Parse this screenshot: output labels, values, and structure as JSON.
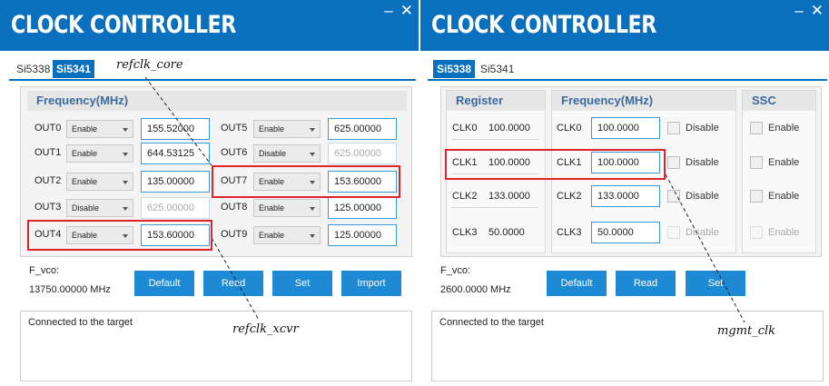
{
  "left": {
    "title": "CLOCK CONTROLLER",
    "window_controls": {
      "minimize": "–",
      "close": "✕"
    },
    "tabs": [
      {
        "label": "Si5338",
        "active": false
      },
      {
        "label": "Si5341",
        "active": true
      }
    ],
    "group_title": "Frequency(MHz)",
    "outputs": [
      {
        "name": "OUT0",
        "mode": "Enable",
        "freq": "155.52000",
        "enabled": true
      },
      {
        "name": "OUT1",
        "mode": "Enable",
        "freq": "644.53125",
        "enabled": true
      },
      {
        "name": "OUT2",
        "mode": "Enable",
        "freq": "135.00000",
        "enabled": true
      },
      {
        "name": "OUT3",
        "mode": "Disable",
        "freq": "625.00000",
        "enabled": false
      },
      {
        "name": "OUT4",
        "mode": "Enable",
        "freq": "153.60000",
        "enabled": true
      },
      {
        "name": "OUT5",
        "mode": "Enable",
        "freq": "625.00000",
        "enabled": true
      },
      {
        "name": "OUT6",
        "mode": "Disable",
        "freq": "625.00000",
        "enabled": false
      },
      {
        "name": "OUT7",
        "mode": "Enable",
        "freq": "153.60000",
        "enabled": true
      },
      {
        "name": "OUT8",
        "mode": "Enable",
        "freq": "125.00000",
        "enabled": true
      },
      {
        "name": "OUT9",
        "mode": "Enable",
        "freq": "125.00000",
        "enabled": true
      }
    ],
    "fvco_label": "F_vco:",
    "fvco_value": "13750.00000 MHz",
    "buttons": {
      "default": "Default",
      "read": "Read",
      "set": "Set",
      "import": "Import"
    },
    "status": "Connected to the target"
  },
  "right": {
    "title": "CLOCK CONTROLLER",
    "window_controls": {
      "minimize": "–",
      "close": "✕"
    },
    "tabs": [
      {
        "label": "Si5338",
        "active": true
      },
      {
        "label": "Si5341",
        "active": false
      }
    ],
    "headers": {
      "register": "Register",
      "frequency": "Frequency(MHz)",
      "ssc": "SSC"
    },
    "clocks": [
      {
        "name": "CLK0",
        "reg_value": "100.0000",
        "freq": "100.0000",
        "disable_label": "Disable",
        "ssc_label": "Enable",
        "enabled": true
      },
      {
        "name": "CLK1",
        "reg_value": "100.0000",
        "freq": "100.0000",
        "disable_label": "Disable",
        "ssc_label": "Enable",
        "enabled": true
      },
      {
        "name": "CLK2",
        "reg_value": "133.0000",
        "freq": "133.0000",
        "disable_label": "Disable",
        "ssc_label": "Enable",
        "enabled": true
      },
      {
        "name": "CLK3",
        "reg_value": "50.0000",
        "freq": "50.0000",
        "disable_label": "Disable",
        "ssc_label": "Enable",
        "enabled": false
      }
    ],
    "fvco_label": "F_vco:",
    "fvco_value": "2600.0000 MHz",
    "buttons": {
      "default": "Default",
      "read": "Read",
      "set": "Set"
    },
    "status": "Connected to the target"
  },
  "annotations": {
    "refclk_core": "refclk_core",
    "refclk_xcvr": "refclk_xcvr",
    "mgmt_clk": "mgmt_clk"
  },
  "colors": {
    "title_bar": "#0a6fbc",
    "button": "#1e8ad4",
    "highlight": "#e0232a"
  }
}
